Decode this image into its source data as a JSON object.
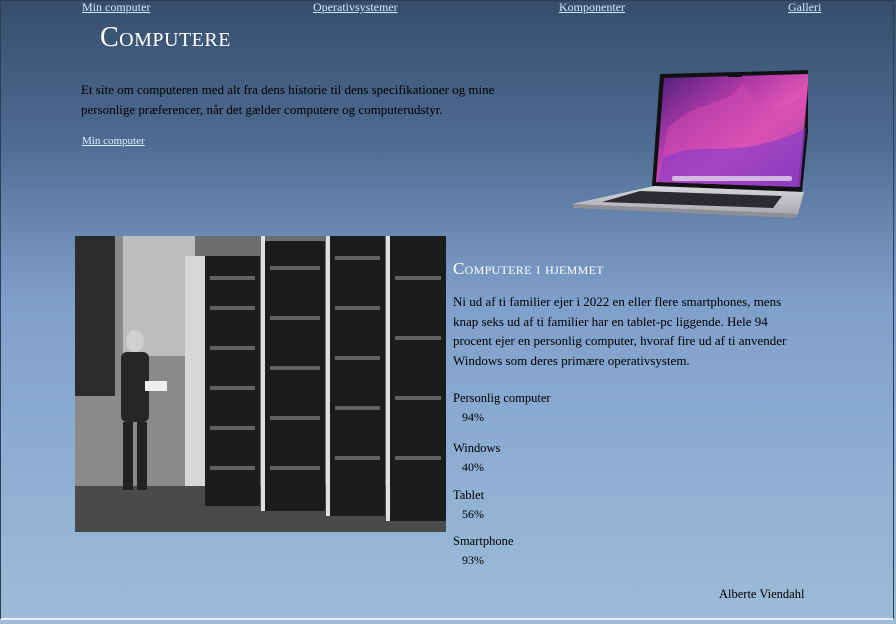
{
  "nav": {
    "items": [
      "Min computer",
      "Operativsystemer",
      "Komponenter",
      "Galleri"
    ]
  },
  "header": {
    "title": "Computere",
    "intro": "Et site om computeren med alt fra dens historie til dens specifikationer og mine personlige præferencer, når det gælder computere og computerudstyr.",
    "link_label": "Min computer"
  },
  "section": {
    "title": "Computere i hjemmet",
    "text": "Ni ud af ti familier ejer i 2022 en eller flere smartphones, mens knap seks ud af ti familier har en tablet-pc liggende. Hele 94 procent ejer en personlig computer, hvoraf fire ud af ti anvender Windows som deres primære operativsystem.",
    "stats": [
      {
        "label": "Personlig computer",
        "value": "94%"
      },
      {
        "label": "Windows",
        "value": "40%"
      },
      {
        "label": "Tablet",
        "value": "56%"
      },
      {
        "label": "Smartphone",
        "value": "93%"
      }
    ]
  },
  "footer": {
    "author": "Alberte Viendahl"
  },
  "colors": {
    "title": "#ffffff",
    "link": "#cfe9ff",
    "background_top": "#364e6c",
    "background_bottom": "#9dbcd8"
  },
  "images": {
    "laptop": "laptop-illustration",
    "photo": "vintage-computer-room-photo"
  }
}
